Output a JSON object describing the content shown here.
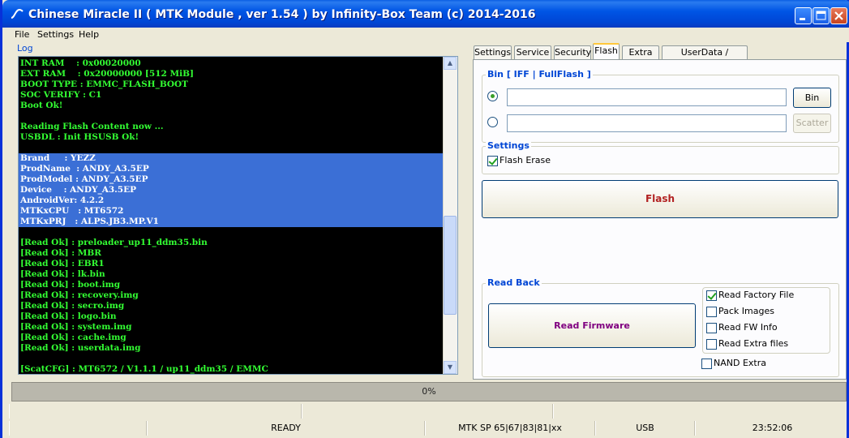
{
  "window": {
    "title": "Chinese Miracle II ( MTK Module , ver 1.54 ) by Infinity-Box Team (c) 2014-2016",
    "app_icon": "infinity-wave-icon",
    "accent_color": "#0055e5"
  },
  "menu": [
    "File",
    "Settings",
    "Help"
  ],
  "log": {
    "label": "Log",
    "lines": [
      {
        "text": "INT RAM    : 0x00020000",
        "sel": false
      },
      {
        "text": "EXT RAM    : 0x20000000 [512 MiB]",
        "sel": false
      },
      {
        "text": "BOOT TYPE : EMMC_FLASH_BOOT",
        "sel": false
      },
      {
        "text": "SOC VERIFY : C1",
        "sel": false
      },
      {
        "text": "Boot Ok!",
        "sel": false
      },
      {
        "text": "",
        "sel": false
      },
      {
        "text": "Reading Flash Content now ...",
        "sel": false
      },
      {
        "text": "USBDL : Init HSUSB Ok!",
        "sel": false
      },
      {
        "text": "",
        "sel": false
      },
      {
        "text": "Brand     : YEZZ",
        "sel": true
      },
      {
        "text": "ProdName  : ANDY_A3.5EP",
        "sel": true
      },
      {
        "text": "ProdModel : ANDY_A3.5EP",
        "sel": true
      },
      {
        "text": "Device    : ANDY_A3.5EP",
        "sel": true
      },
      {
        "text": "AndroidVer: 4.2.2",
        "sel": true
      },
      {
        "text": "MTKxCPU   : MT6572",
        "sel": true
      },
      {
        "text": "MTKxPRJ   : ALPS.JB3.MP.V1",
        "sel": true
      },
      {
        "text": "",
        "sel": false
      },
      {
        "text": "[Read Ok] : preloader_up11_ddm35.bin",
        "sel": false
      },
      {
        "text": "[Read Ok] : MBR",
        "sel": false
      },
      {
        "text": "[Read Ok] : EBR1",
        "sel": false
      },
      {
        "text": "[Read Ok] : lk.bin",
        "sel": false
      },
      {
        "text": "[Read Ok] : boot.img",
        "sel": false
      },
      {
        "text": "[Read Ok] : recovery.img",
        "sel": false
      },
      {
        "text": "[Read Ok] : secro.img",
        "sel": false
      },
      {
        "text": "[Read Ok] : logo.bin",
        "sel": false
      },
      {
        "text": "[Read Ok] : system.img",
        "sel": false
      },
      {
        "text": "[Read Ok] : cache.img",
        "sel": false
      },
      {
        "text": "[Read Ok] : userdata.img",
        "sel": false
      },
      {
        "text": "",
        "sel": false
      },
      {
        "text": "[ScatCFG] : MT6572 / V1.1.1 / up11_ddm35 / EMMC",
        "sel": false
      }
    ]
  },
  "tabs": [
    {
      "label": "Settings",
      "active": false
    },
    {
      "label": "Service",
      "active": false
    },
    {
      "label": "Security",
      "active": false
    },
    {
      "label": "Flash",
      "active": true
    },
    {
      "label": "Extra",
      "active": false
    },
    {
      "label": "UserData / Forensic",
      "active": false
    }
  ],
  "flash": {
    "bin_group_title": "Bin  [ IFF | FullFlash ]",
    "bin_path": "",
    "scatter_path": "",
    "bin_button": "Bin",
    "scatter_button": "Scatter",
    "settings_title": "Settings",
    "flash_erase_label": "Flash Erase",
    "flash_erase_checked": true,
    "flash_button": "Flash",
    "flash_button_color": "#b22222"
  },
  "readback": {
    "title": "Read Back",
    "read_firmware_button": "Read Firmware",
    "read_firmware_color": "#800080",
    "options": [
      {
        "label": "Read Factory File",
        "checked": true
      },
      {
        "label": "Pack Images",
        "checked": false
      },
      {
        "label": "Read FW Info",
        "checked": false
      },
      {
        "label": "Read Extra files",
        "checked": false
      }
    ],
    "nand_extra_label": "NAND Extra",
    "nand_extra_checked": false
  },
  "progress": {
    "text": "0%",
    "value": 0
  },
  "status": {
    "state": "READY",
    "protocol": "MTK SP 65|67|83|81|xx",
    "connection": "USB",
    "time": "23:52:06"
  }
}
